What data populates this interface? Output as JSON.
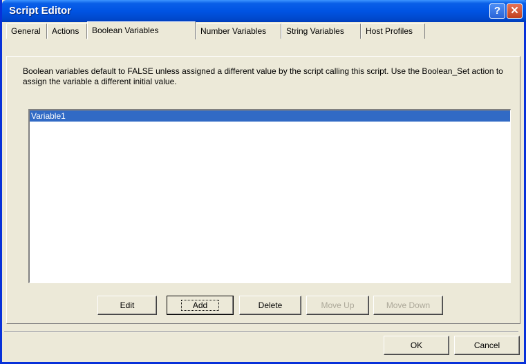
{
  "window": {
    "title": "Script Editor"
  },
  "tabs": [
    {
      "label": "General",
      "active": false
    },
    {
      "label": "Actions",
      "active": false
    },
    {
      "label": "Boolean Variables",
      "active": true
    },
    {
      "label": "Number Variables",
      "active": false
    },
    {
      "label": "String Variables",
      "active": false
    },
    {
      "label": "Host Profiles",
      "active": false
    }
  ],
  "panel": {
    "description": "Boolean variables default to FALSE unless assigned a different value by the script calling this script.  Use the Boolean_Set action to assign the variable a different initial value.",
    "variables": [
      {
        "label": "Variable1",
        "selected": true
      }
    ]
  },
  "buttons": {
    "edit": "Edit",
    "add": "Add",
    "delete": "Delete",
    "move_up": "Move Up",
    "move_down": "Move Down",
    "ok": "OK",
    "cancel": "Cancel"
  },
  "colors": {
    "title_bar": "#0054e3",
    "selection": "#316ac5",
    "face": "#ece9d8"
  }
}
